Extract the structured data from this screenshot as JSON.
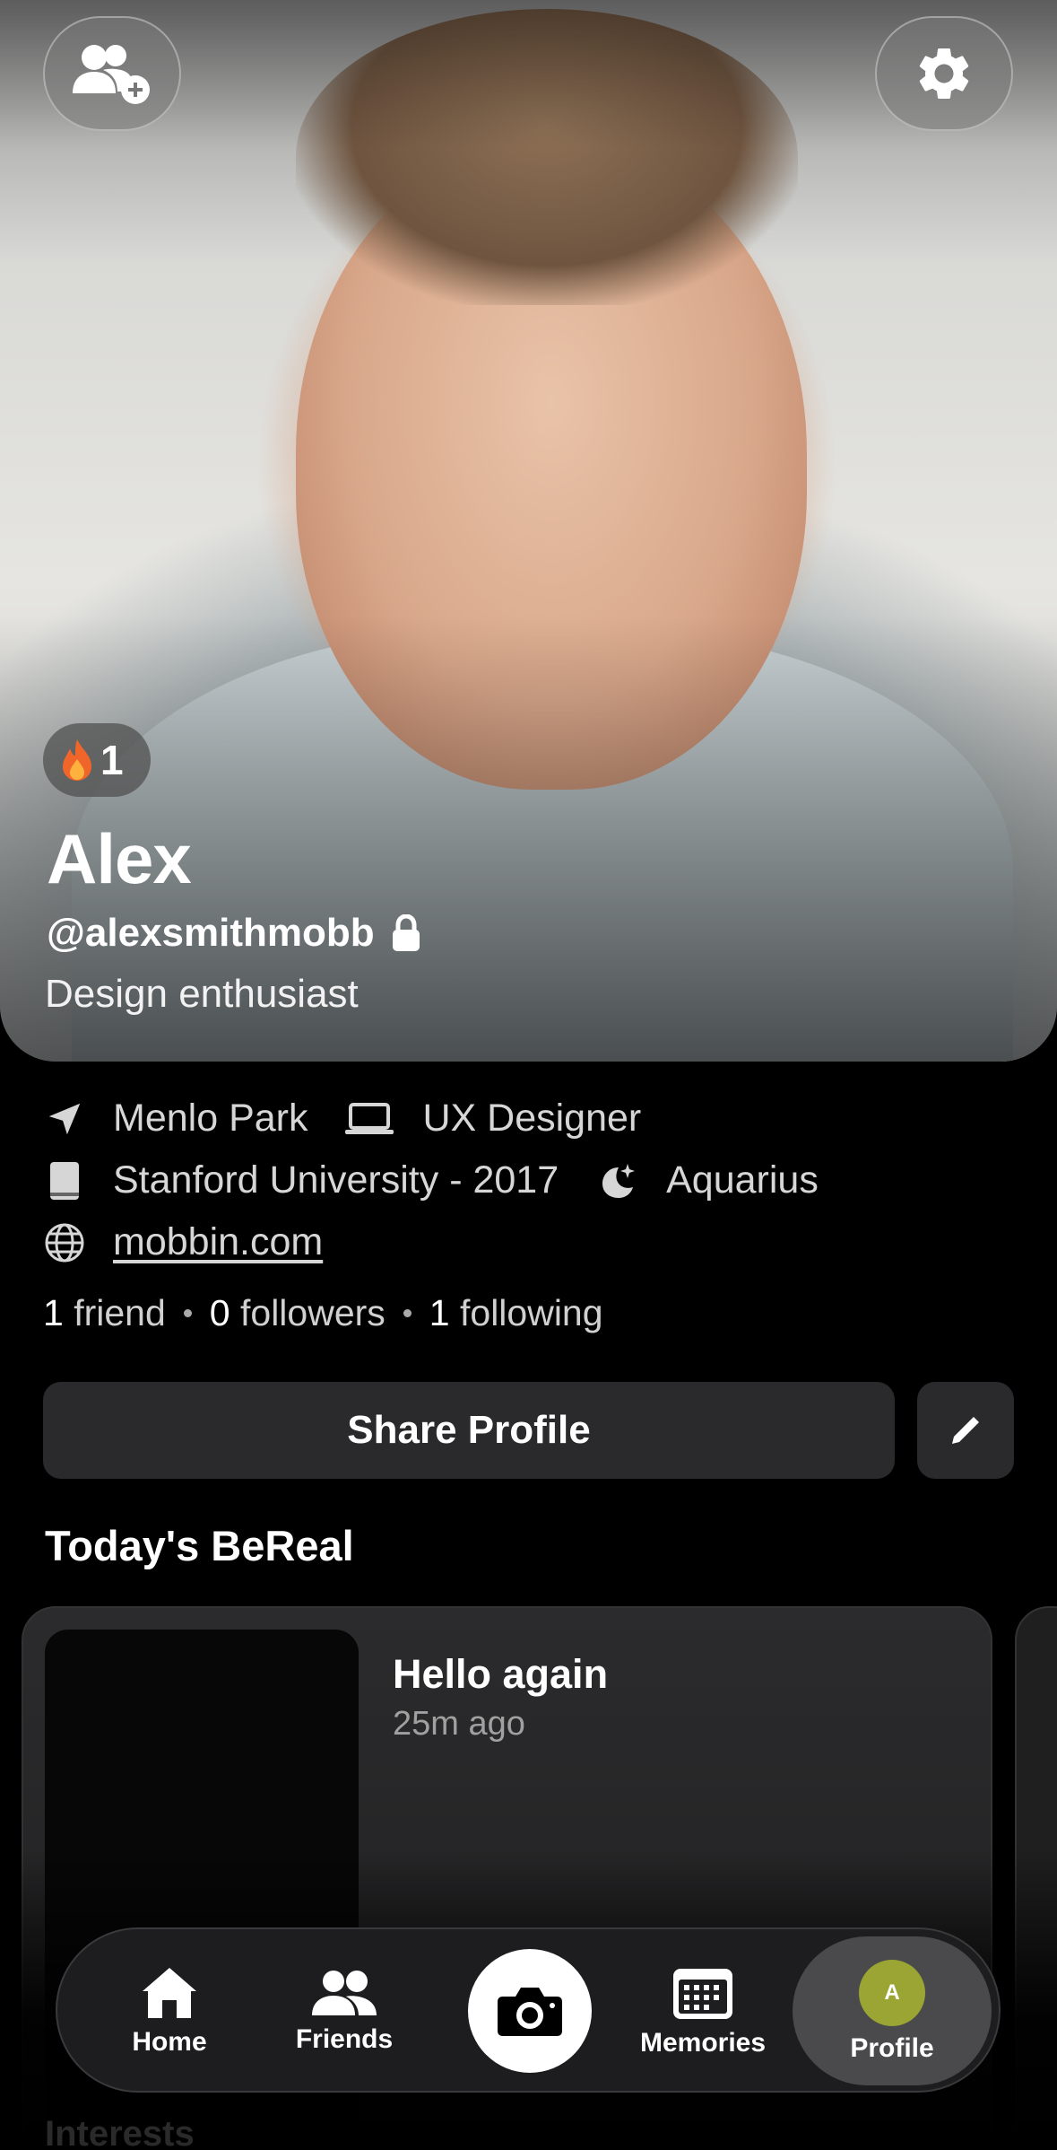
{
  "header": {
    "add_friend_icon": "add-friend-icon",
    "settings_icon": "gear-icon"
  },
  "profile": {
    "streak_count": "1",
    "name": "Alex",
    "username": "@alexsmithmobb",
    "bio": "Design enthusiast",
    "location": "Menlo Park",
    "job": "UX Designer",
    "school": "Stanford University - 2017",
    "zodiac": "Aquarius",
    "website": "mobbin.com"
  },
  "counts": {
    "friends_num": "1",
    "friends_label": "friend",
    "followers_num": "0",
    "followers_label": "followers",
    "following_num": "1",
    "following_label": "following"
  },
  "actions": {
    "share_label": "Share Profile"
  },
  "section": {
    "title": "Today's BeReal"
  },
  "post": {
    "title": "Hello again",
    "time": "25m ago"
  },
  "below": {
    "title": "Interests"
  },
  "tabbar": {
    "home": "Home",
    "friends": "Friends",
    "memories": "Memories",
    "profile": "Profile",
    "avatar_initial": "A"
  },
  "colors": {
    "background": "#000000",
    "surface": "#2a2a2c",
    "avatar": "#9aa533"
  }
}
